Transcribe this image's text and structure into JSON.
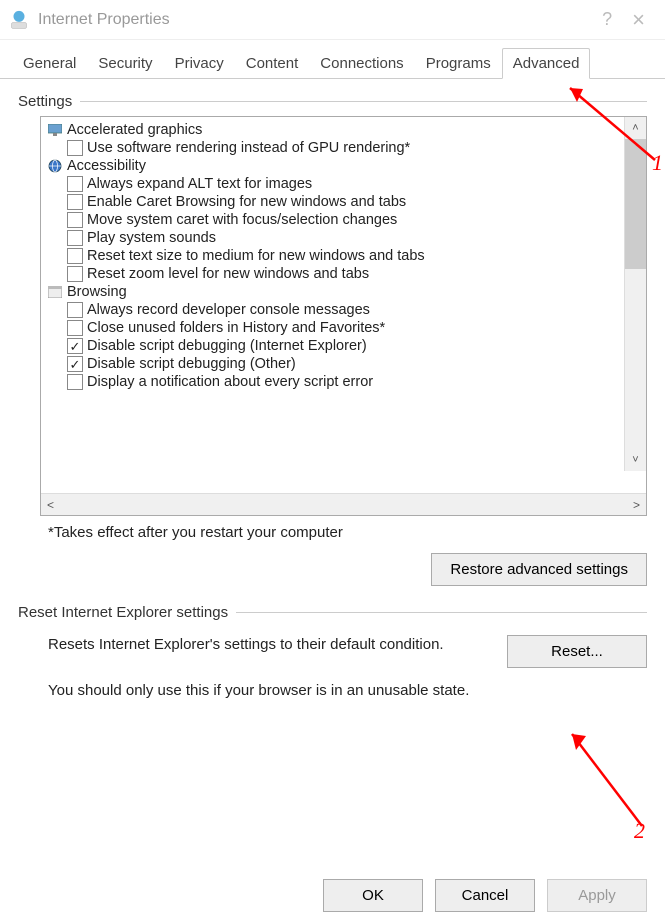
{
  "window": {
    "title": "Internet Properties",
    "help_icon": "?",
    "close_icon": "×"
  },
  "tabs": [
    {
      "label": "General",
      "active": false
    },
    {
      "label": "Security",
      "active": false
    },
    {
      "label": "Privacy",
      "active": false
    },
    {
      "label": "Content",
      "active": false
    },
    {
      "label": "Connections",
      "active": false
    },
    {
      "label": "Programs",
      "active": false
    },
    {
      "label": "Advanced",
      "active": true
    }
  ],
  "settings": {
    "group_label": "Settings",
    "categories": [
      {
        "name": "Accelerated graphics",
        "icon": "monitor-icon",
        "options": [
          {
            "label": "Use software rendering instead of GPU rendering*",
            "checked": false
          }
        ]
      },
      {
        "name": "Accessibility",
        "icon": "globe-icon",
        "options": [
          {
            "label": "Always expand ALT text for images",
            "checked": false
          },
          {
            "label": "Enable Caret Browsing for new windows and tabs",
            "checked": false
          },
          {
            "label": "Move system caret with focus/selection changes",
            "checked": false
          },
          {
            "label": "Play system sounds",
            "checked": false
          },
          {
            "label": "Reset text size to medium for new windows and tabs",
            "checked": false
          },
          {
            "label": "Reset zoom level for new windows and tabs",
            "checked": false
          }
        ]
      },
      {
        "name": "Browsing",
        "icon": "browsing-icon",
        "options": [
          {
            "label": "Always record developer console messages",
            "checked": false
          },
          {
            "label": "Close unused folders in History and Favorites*",
            "checked": false
          },
          {
            "label": "Disable script debugging (Internet Explorer)",
            "checked": true
          },
          {
            "label": "Disable script debugging (Other)",
            "checked": true
          },
          {
            "label": "Display a notification about every script error",
            "checked": false
          }
        ]
      }
    ],
    "note": "*Takes effect after you restart your computer",
    "restore_button": "Restore advanced settings"
  },
  "reset": {
    "group_label": "Reset Internet Explorer settings",
    "description": "Resets Internet Explorer's settings to their default condition.",
    "button": "Reset...",
    "warning": "You should only use this if your browser is in an unusable state."
  },
  "dialog_buttons": {
    "ok": "OK",
    "cancel": "Cancel",
    "apply": "Apply"
  },
  "annotations": {
    "label1": "1",
    "label2": "2"
  }
}
